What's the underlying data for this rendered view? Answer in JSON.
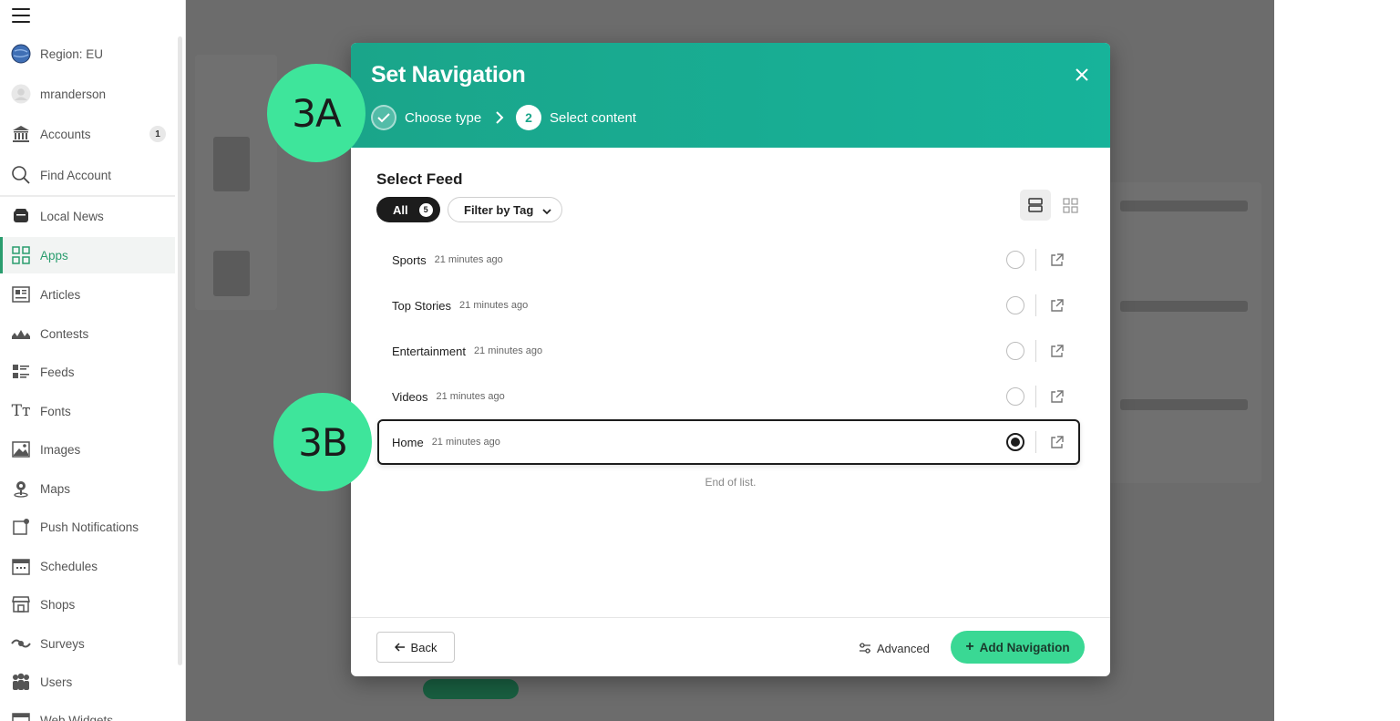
{
  "sidebar": {
    "region": "Region: EU",
    "user": "mranderson",
    "items": [
      {
        "label": "Accounts",
        "badge": "1"
      },
      {
        "label": "Find Account"
      },
      {
        "label": "Local News"
      },
      {
        "label": "Apps",
        "active": true
      },
      {
        "label": "Articles"
      },
      {
        "label": "Contests"
      },
      {
        "label": "Feeds"
      },
      {
        "label": "Fonts"
      },
      {
        "label": "Images"
      },
      {
        "label": "Maps"
      },
      {
        "label": "Push Notifications"
      },
      {
        "label": "Schedules"
      },
      {
        "label": "Shops"
      },
      {
        "label": "Surveys"
      },
      {
        "label": "Users"
      },
      {
        "label": "Web Widgets"
      }
    ]
  },
  "modal": {
    "title": "Set Navigation",
    "steps": [
      {
        "label": "Choose type",
        "state": "done"
      },
      {
        "number": "2",
        "label": "Select content",
        "state": "current"
      }
    ],
    "section_title": "Select Feed",
    "filter_all_label": "All",
    "filter_all_count": "5",
    "filter_tag_label": "Filter by Tag",
    "feeds": [
      {
        "name": "Sports",
        "time": "21 minutes ago",
        "selected": false
      },
      {
        "name": "Top Stories",
        "time": "21 minutes ago",
        "selected": false
      },
      {
        "name": "Entertainment",
        "time": "21 minutes ago",
        "selected": false
      },
      {
        "name": "Videos",
        "time": "21 minutes ago",
        "selected": false
      },
      {
        "name": "Home",
        "time": "21 minutes ago",
        "selected": true
      }
    ],
    "end_of_list": "End of list.",
    "back_label": "Back",
    "advanced_label": "Advanced",
    "add_label": "Add Navigation"
  },
  "callouts": {
    "a": "3A",
    "b": "3B"
  },
  "colors": {
    "header": "#1aa58a",
    "accent": "#3ad894",
    "callout": "#3ee59b",
    "active_nav": "#2a9d6e"
  }
}
